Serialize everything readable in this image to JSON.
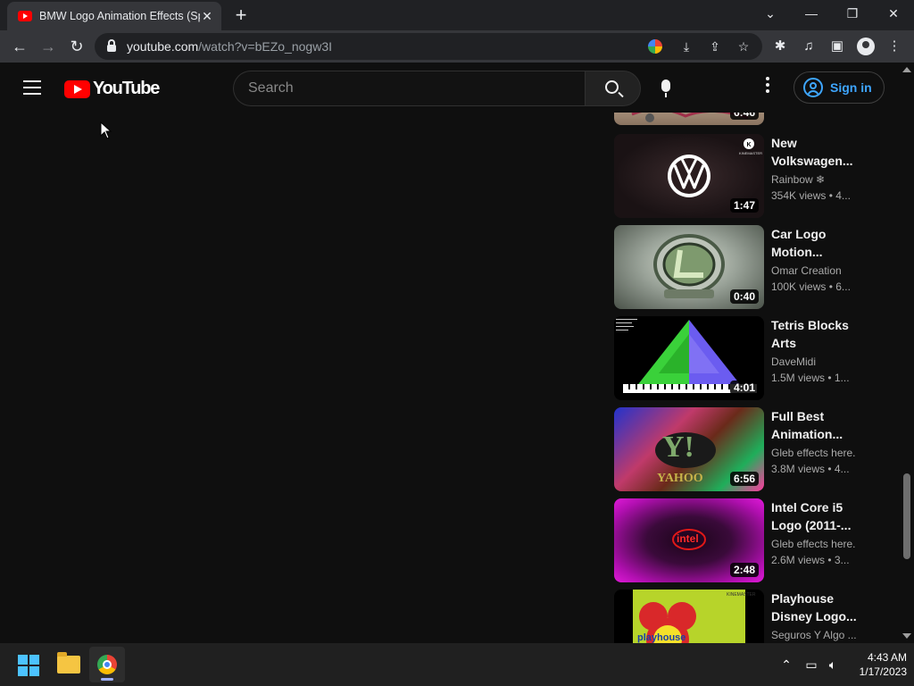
{
  "browser": {
    "tab_title": "BMW Logo Animation Effects (Sp",
    "tab_close": "✕",
    "new_tab": "+",
    "url_host": "youtube.com",
    "url_path": "/watch?v=bEZo_nogw3I",
    "window_controls": {
      "minimize": "—",
      "restore": "❐",
      "close": "✕",
      "dropdown": "⌄"
    },
    "nav": {
      "back": "←",
      "forward": "→",
      "reload": "↻"
    },
    "icons": [
      "google-icon",
      "install-icon",
      "share-icon",
      "bookmark-star-icon",
      "extensions-icon",
      "media-icon",
      "side-panel-icon",
      "profile-icon",
      "menu-icon"
    ]
  },
  "youtube": {
    "logo_text": "YouTube",
    "search_placeholder": "Search",
    "signin_label": "Sign in"
  },
  "recommendations": [
    {
      "title": "",
      "channel": "",
      "meta": "",
      "duration": "6:46",
      "thumb": "partial"
    },
    {
      "title": "New Volkswagen...",
      "channel": "Rainbow ❄",
      "meta": "354K views  • 4...",
      "duration": "1:47",
      "thumb": "vw"
    },
    {
      "title": "Car Logo Motion...",
      "channel": "Omar Creation",
      "meta": "100K views  • 6...",
      "duration": "0:40",
      "thumb": "lexus"
    },
    {
      "title": "Tetris Blocks Arts",
      "channel": "DaveMidi",
      "meta": "1.5M views  • 1...",
      "duration": "4:01",
      "thumb": "tetris"
    },
    {
      "title": "Full Best Animation...",
      "channel": "Gleb effects here.",
      "meta": "3.8M views  • 4...",
      "duration": "6:56",
      "thumb": "yahoo"
    },
    {
      "title": "Intel Core i5 Logo (2011-...",
      "channel": "Gleb effects here.",
      "meta": "2.6M views  • 3...",
      "duration": "2:48",
      "thumb": "intel"
    },
    {
      "title": "Playhouse Disney Logo...",
      "channel": "Seguros Y Algo ...",
      "meta": "",
      "duration": "",
      "thumb": "playhouse"
    }
  ],
  "thumbnail_text": {
    "vw_badge": "KINEMASTER",
    "yahoo": "Y!",
    "yahoo_word": "YAHOO",
    "intel": "intel",
    "playhouse": "playhouse",
    "playhouse_badge": "KINEMASTER"
  },
  "taskbar": {
    "time": "4:43 AM",
    "date": "1/17/2023"
  },
  "colors": {
    "youtube_red": "#ff0000",
    "link_blue": "#3ea6ff",
    "background": "#0f0f0f"
  }
}
